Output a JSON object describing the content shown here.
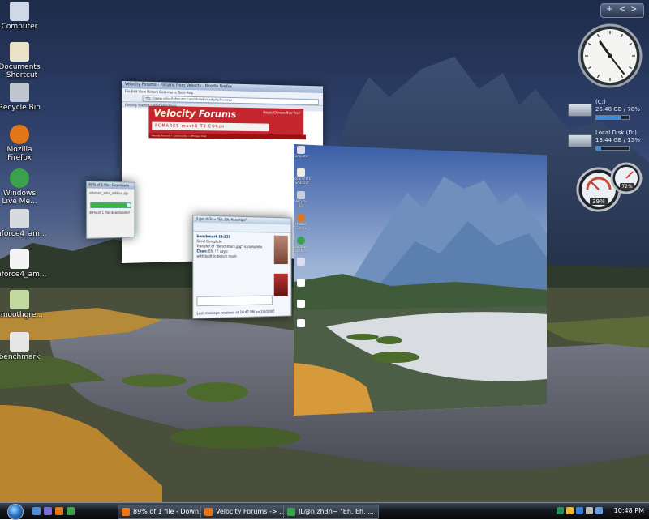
{
  "desktop": {
    "icons": [
      {
        "label": "Computer",
        "color": "#cfd8e6"
      },
      {
        "label": "Documents - Shortcut",
        "color": "#e9e4c8"
      },
      {
        "label": "Recycle Bin",
        "color": "#bfc6cf"
      },
      {
        "label": "Mozilla Firefox",
        "color": "#e2761b"
      },
      {
        "label": "Windows Live Me...",
        "color": "#3aa24b"
      },
      {
        "label": "nforce4_am...",
        "color": "#d7dbe0"
      },
      {
        "label": "nforce4_am...",
        "color": "#f4f4f4"
      },
      {
        "label": "smoothgre...",
        "color": "#c2d9a0"
      },
      {
        "label": "benchmark",
        "color": "#e6e6e6"
      }
    ]
  },
  "flip3d": {
    "browser": {
      "title": "Velocity Forums - Forums from Velocity - Mozilla Firefox",
      "menu": "File  Edit  View  History  Bookmarks  Tools  Help",
      "url": "http://www.velocityforums.com/showthread.php?t=xxxx",
      "tab": "Getting Started   Latest Headlines",
      "logo_a": "Velocity",
      "logo_b": " Forums",
      "banner_text": "Happy Chinese New Year!",
      "ad_text": "PCMARKS  maxtll  T3  CUhen",
      "nav_text": "Velocity Forums > Community > Off-topic Chat"
    },
    "transfer": {
      "title": "89% of 1 file - Downloads",
      "file": "nforce4_amd_edition.zip",
      "progress": 0.89,
      "status": "89% of 1 file downloaded"
    },
    "chat": {
      "title": "JL@n zh3n~ \"Eh, Eh, fixes tips\"",
      "lines": [
        {
          "who": "benchmark (B:32)",
          "text": "Send Complete"
        },
        {
          "who": "",
          "text": "Transfer of \"benchmark.jpg\" is complete."
        },
        {
          "who": "Chan:",
          "text": "Eh, !!! says:"
        },
        {
          "who": "",
          "text": "with built in bench mark"
        }
      ],
      "footer": "Last message received at 10:47 PM on 2/3/2007",
      "ad": "Win a Lenovo desktop or notebook in the Explore Lenovo Contest!"
    }
  },
  "sidebar": {
    "controls": [
      "+",
      "<",
      ">"
    ],
    "drives": [
      {
        "name": "(C:)",
        "size": "25.48 GB / 78%",
        "usage": 0.78
      },
      {
        "name": "Local Disk (D:)",
        "size": "13.44 GB / 15%",
        "usage": 0.15
      }
    ],
    "meter": {
      "cpu": "39%",
      "memory": "72%"
    }
  },
  "taskbar": {
    "tasks": [
      {
        "label": "89% of 1 file - Down...",
        "color": "#e57a1f"
      },
      {
        "label": "Velocity Forums -> ...",
        "color": "#e2761b"
      },
      {
        "label": "JL@n zh3n~ \"Eh, Eh, ...",
        "color": "#3aa24b"
      }
    ],
    "quicklaunch_colors": [
      "#4f8dd6",
      "#7b6fd4",
      "#e2761b",
      "#3aa24b"
    ],
    "tray_colors": [
      "#2e8b57",
      "#e9b53a",
      "#3b7fd1",
      "#bbbbbb",
      "#6a9cd8"
    ],
    "time": "10:48 PM"
  }
}
